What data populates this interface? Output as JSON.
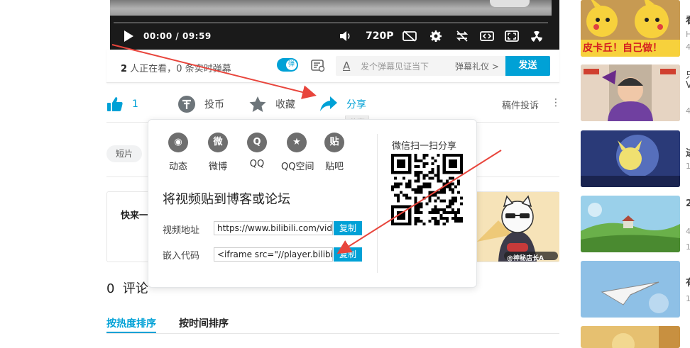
{
  "player": {
    "time_current": "00:00",
    "time_sep": "/",
    "time_total": "09:59",
    "quality": "720P",
    "icons": [
      "play-icon",
      "volume-icon",
      "danmaku-off-icon",
      "settings-icon",
      "loop-icon",
      "widescreen-icon",
      "fullscreen-icon",
      "radiation-icon"
    ]
  },
  "danmaku": {
    "viewers_count": "2",
    "viewers_text": " 人正在看，",
    "danmaku_count": "0",
    "danmaku_text": " 条实时弹幕",
    "toggle_label": "弹",
    "input_prefix": "A",
    "placeholder": "发个弹幕见证当下",
    "etiquette": "弹幕礼仪 >",
    "send": "发送"
  },
  "actions": {
    "like_count": "1",
    "coin": "投币",
    "favorite": "收藏",
    "share": "分享",
    "report": "稿件投诉",
    "more": "⋮",
    "tooltip": "分享"
  },
  "tags": [
    "短片"
  ],
  "card": {
    "title": "快来一"
  },
  "comments": {
    "count": "0",
    "label": "评论",
    "sort_hot": "按热度排序",
    "sort_time": "按时间排序"
  },
  "share_popup": {
    "platforms": [
      {
        "label": "动态",
        "glyph": "◉"
      },
      {
        "label": "微博",
        "glyph": "微"
      },
      {
        "label": "QQ",
        "glyph": "Q"
      },
      {
        "label": "QQ空间",
        "glyph": "★"
      },
      {
        "label": "贴吧",
        "glyph": "贴"
      }
    ],
    "embed_title": "将视频贴到博客或论坛",
    "video_url_label": "视频地址",
    "video_url_value": "https://www.bilibili.com/video/a",
    "embed_code_label": "嵌入代码",
    "embed_code_value": "<iframe src=\"//player.bilibili.com",
    "copy": "复制",
    "qr_title": "微信扫一扫分享"
  },
  "sidebar": {
    "thumb1_caption": "皮卡丘！自己做！",
    "thumb6_badge": "@神秘店长A",
    "side_chars": [
      "看",
      "H",
      "4",
      "只",
      "V",
      "4",
      "进",
      "1",
      "2",
      "4",
      "1",
      "有",
      "1"
    ]
  },
  "colors": {
    "accent": "#00a1d6",
    "arrow": "#e8453c"
  }
}
